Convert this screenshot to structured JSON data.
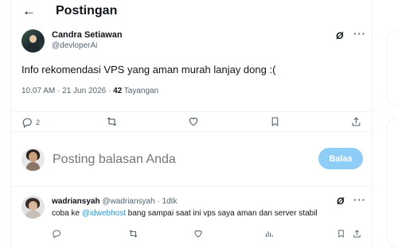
{
  "header": {
    "back_glyph": "←",
    "title": "Postingan"
  },
  "post": {
    "author_name": "Candra Setiawan",
    "author_handle": "@devloperAi",
    "grok_glyph": "Ø",
    "more_glyph": "···",
    "text": "Info rekomendasi VPS yang aman murah lanjay dong :(",
    "timestamp": "10.07 AM · 21 Jun 2026 · ",
    "views_count": "42",
    "views_label": " Tayangan",
    "actions": {
      "reply_count": "2",
      "reply_icon": "reply-icon",
      "repost_icon": "repost-icon",
      "like_icon": "heart-icon",
      "bookmark_icon": "bookmark-icon",
      "share_icon": "share-icon"
    }
  },
  "composer": {
    "placeholder": "Posting balasan Anda",
    "button_label": "Balas",
    "button_color": "#8ecdf7"
  },
  "comment": {
    "author_name": "wadriansyah",
    "author_meta": " @wadriansyah · 1dtk",
    "text_before": "coba ke ",
    "mention": "@idwebhost",
    "text_after": " bang sampai saat ini vps saya aman dan server stabil",
    "grok_glyph": "Ø",
    "more_glyph": "···"
  },
  "colors": {
    "accent": "#1d9bf0",
    "muted": "#536471",
    "border": "#eff3f4"
  }
}
